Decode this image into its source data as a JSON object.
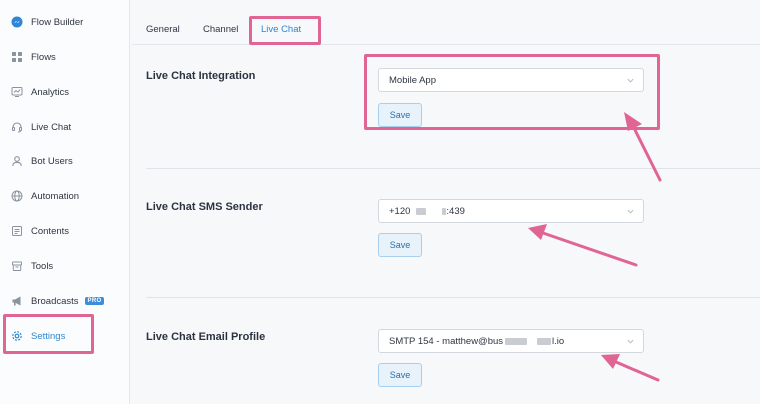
{
  "sidebar": {
    "items": [
      {
        "label": "Flow Builder",
        "icon": "messenger-icon"
      },
      {
        "label": "Flows",
        "icon": "grid-icon"
      },
      {
        "label": "Analytics",
        "icon": "chart-icon"
      },
      {
        "label": "Live Chat",
        "icon": "headset-icon"
      },
      {
        "label": "Bot Users",
        "icon": "user-icon"
      },
      {
        "label": "Automation",
        "icon": "globe-icon"
      },
      {
        "label": "Contents",
        "icon": "document-icon"
      },
      {
        "label": "Tools",
        "icon": "box-icon"
      },
      {
        "label": "Broadcasts",
        "icon": "megaphone-icon",
        "badge": "PRO"
      },
      {
        "label": "Settings",
        "icon": "gear-icon",
        "active": true
      }
    ]
  },
  "tabs": [
    {
      "label": "General"
    },
    {
      "label": "Channel"
    },
    {
      "label": "Live Chat",
      "active": true
    }
  ],
  "sections": [
    {
      "title": "Live Chat Integration",
      "value": "Mobile App",
      "save_label": "Save"
    },
    {
      "title": "Live Chat SMS Sender",
      "value_prefix": "+120",
      "value_suffix": ":439",
      "save_label": "Save"
    },
    {
      "title": "Live Chat Email Profile",
      "value_prefix": "SMTP 154 - matthew@bus",
      "value_suffix": "l.io",
      "save_label": "Save"
    }
  ],
  "colors": {
    "accent": "#2e86d4",
    "highlight": "#e06593",
    "badge": "#3d8ed8"
  }
}
